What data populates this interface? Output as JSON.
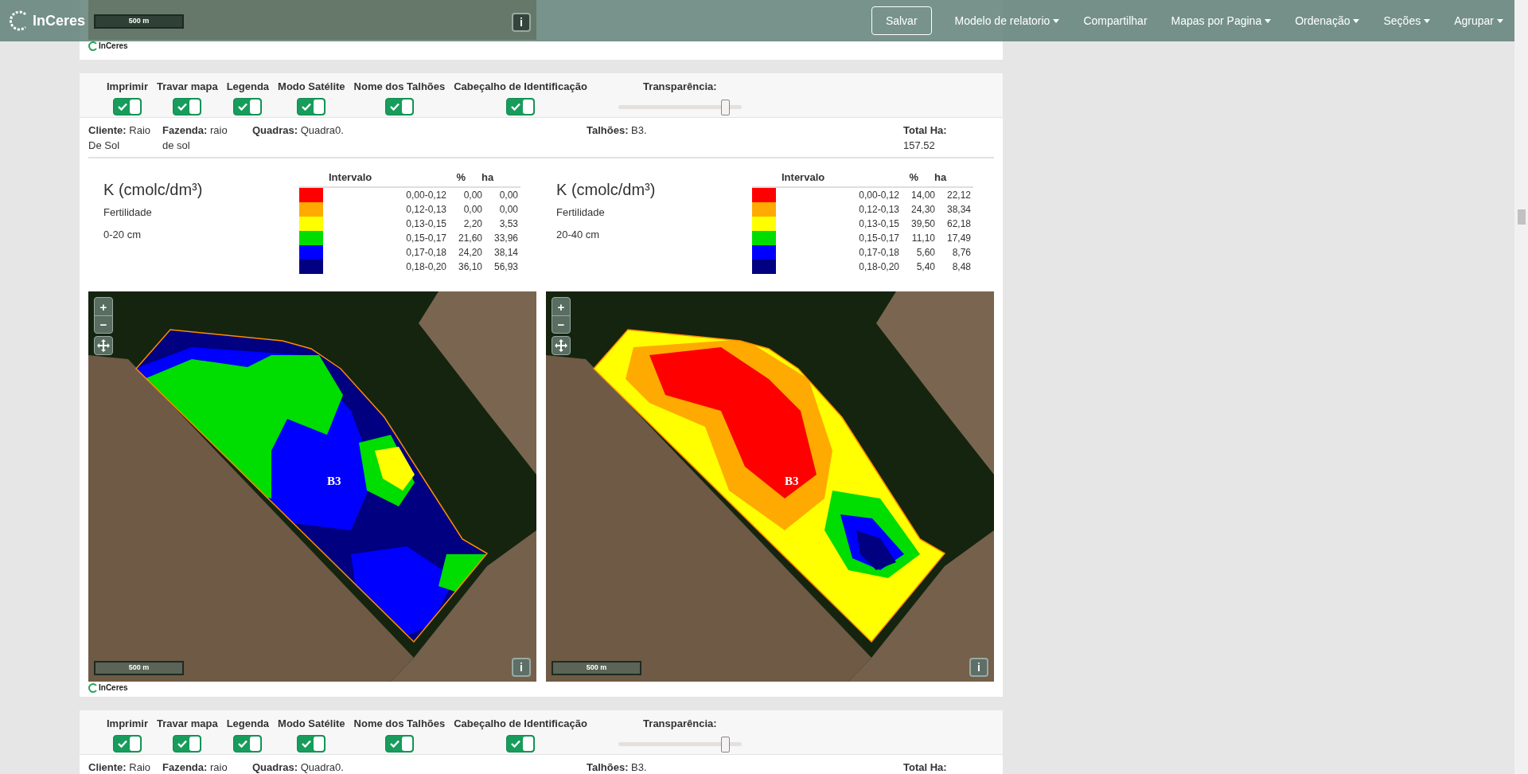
{
  "navbar": {
    "brand": "InCeres",
    "items": [
      {
        "label": "Salvar",
        "kind": "button"
      },
      {
        "label": "Modelo de relatorio",
        "kind": "dropdown"
      },
      {
        "label": "Compartilhar",
        "kind": "link"
      },
      {
        "label": "Mapas por Pagina",
        "kind": "dropdown"
      },
      {
        "label": "Ordenação",
        "kind": "dropdown"
      },
      {
        "label": "Seções",
        "kind": "dropdown"
      },
      {
        "label": "Agrupar",
        "kind": "dropdown"
      }
    ]
  },
  "previous_section": {
    "scale": "500 m",
    "info": "i",
    "logo": "InCeres"
  },
  "sections": [
    {
      "toggles": [
        {
          "label": "Imprimir",
          "on": true
        },
        {
          "label": "Travar mapa",
          "on": true
        },
        {
          "label": "Legenda",
          "on": true
        },
        {
          "label": "Modo Satélite",
          "on": true
        },
        {
          "label": "Nome dos Talhões",
          "on": true
        },
        {
          "label": "Cabeçalho de Identificação",
          "on": true
        }
      ],
      "transparency": {
        "label": "Transparência:",
        "level": 0.87
      },
      "info": [
        {
          "label": "Cliente:",
          "value": "Raio De Sol"
        },
        {
          "label": "Fazenda:",
          "value": "raio de sol"
        },
        {
          "label": "Quadras:",
          "value": "Quadra0."
        },
        {
          "label": "Talhões:",
          "value": "B3."
        },
        {
          "label": "Total Ha:",
          "value": "157.52"
        }
      ],
      "maps": [
        {
          "title": "K (cmolc/dm³)",
          "subtitle": "Fertilidade",
          "depth": "0-20 cm",
          "legend": {
            "columns": [
              "Intervalo",
              "%",
              "ha"
            ],
            "rows": [
              {
                "color": "#ff0000",
                "interval": "0,00-0,12",
                "percent": "0,00",
                "ha": "0,00"
              },
              {
                "color": "#ffaa00",
                "interval": "0,12-0,13",
                "percent": "0,00",
                "ha": "0,00"
              },
              {
                "color": "#ffff00",
                "interval": "0,13-0,15",
                "percent": "2,20",
                "ha": "3,53"
              },
              {
                "color": "#00dd00",
                "interval": "0,15-0,17",
                "percent": "21,60",
                "ha": "33,96"
              },
              {
                "color": "#0000ff",
                "interval": "0,17-0,18",
                "percent": "24,20",
                "ha": "38,14"
              },
              {
                "color": "#000080",
                "interval": "0,18-0,20",
                "percent": "36,10",
                "ha": "56,93"
              }
            ]
          },
          "map": {
            "zoom_in": "+",
            "zoom_out": "−",
            "plot_label": "B3",
            "scale": "500 m",
            "info": "i"
          }
        },
        {
          "title": "K (cmolc/dm³)",
          "subtitle": "Fertilidade",
          "depth": "20-40 cm",
          "legend": {
            "columns": [
              "Intervalo",
              "%",
              "ha"
            ],
            "rows": [
              {
                "color": "#ff0000",
                "interval": "0,00-0,12",
                "percent": "14,00",
                "ha": "22,12"
              },
              {
                "color": "#ffaa00",
                "interval": "0,12-0,13",
                "percent": "24,30",
                "ha": "38,34"
              },
              {
                "color": "#ffff00",
                "interval": "0,13-0,15",
                "percent": "39,50",
                "ha": "62,18"
              },
              {
                "color": "#00dd00",
                "interval": "0,15-0,17",
                "percent": "11,10",
                "ha": "17,49"
              },
              {
                "color": "#0000ff",
                "interval": "0,17-0,18",
                "percent": "5,60",
                "ha": "8,76"
              },
              {
                "color": "#000080",
                "interval": "0,18-0,20",
                "percent": "5,40",
                "ha": "8,48"
              }
            ]
          },
          "map": {
            "zoom_in": "+",
            "zoom_out": "−",
            "plot_label": "B3",
            "scale": "500 m",
            "info": "i"
          }
        }
      ],
      "logo": "InCeres"
    },
    {
      "toggles": [
        {
          "label": "Imprimir",
          "on": true
        },
        {
          "label": "Travar mapa",
          "on": true
        },
        {
          "label": "Legenda",
          "on": true
        },
        {
          "label": "Modo Satélite",
          "on": true
        },
        {
          "label": "Nome dos Talhões",
          "on": true
        },
        {
          "label": "Cabeçalho de Identificação",
          "on": true
        }
      ],
      "transparency": {
        "label": "Transparência:",
        "level": 0.87
      },
      "info": [
        {
          "label": "Cliente:",
          "value": "Raio"
        },
        {
          "label": "Fazenda:",
          "value": "raio"
        },
        {
          "label": "Quadras:",
          "value": "Quadra0."
        },
        {
          "label": "Talhões:",
          "value": "B3."
        },
        {
          "label": "Total Ha:"
        }
      ]
    }
  ]
}
